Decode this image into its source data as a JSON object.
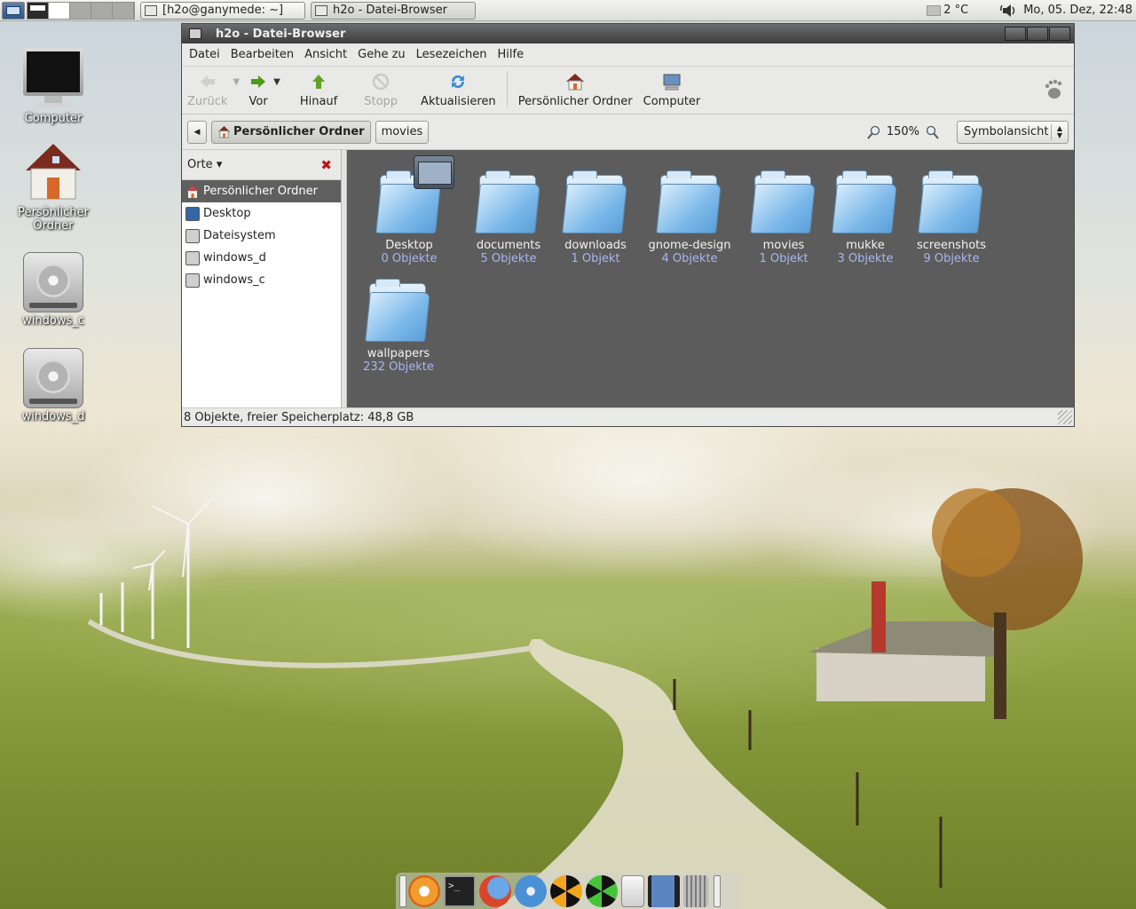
{
  "top_panel": {
    "tasks": [
      {
        "label": "[h2o@ganymede: ~]"
      },
      {
        "label": "h2o - Datei-Browser"
      }
    ],
    "weather": "2 °C",
    "clock": "Mo, 05. Dez, 22:48"
  },
  "desktop": {
    "icons": [
      {
        "label": "Computer"
      },
      {
        "label": "Persönlicher Ordner"
      },
      {
        "label": "windows_c"
      },
      {
        "label": "windows_d"
      }
    ]
  },
  "window": {
    "title": "h2o - Datei-Browser",
    "menu": [
      "Datei",
      "Bearbeiten",
      "Ansicht",
      "Gehe zu",
      "Lesezeichen",
      "Hilfe"
    ],
    "toolbar": {
      "back": "Zurück",
      "forward": "Vor",
      "up": "Hinauf",
      "stop": "Stopp",
      "reload": "Aktualisieren",
      "home": "Persönlicher Ordner",
      "computer": "Computer"
    },
    "location": {
      "crumbs": [
        "Persönlicher Ordner",
        "movies"
      ],
      "zoom": "150%",
      "view": "Symbolansicht"
    },
    "sidebar": {
      "header": "Orte",
      "items": [
        "Persönlicher Ordner",
        "Desktop",
        "Dateisystem",
        "windows_d",
        "windows_c"
      ]
    },
    "files": [
      {
        "name": "Desktop",
        "count": "0 Objekte"
      },
      {
        "name": "documents",
        "count": "5 Objekte"
      },
      {
        "name": "downloads",
        "count": "1 Objekt"
      },
      {
        "name": "gnome-design",
        "count": "4 Objekte"
      },
      {
        "name": "movies",
        "count": "1 Objekt"
      },
      {
        "name": "mukke",
        "count": "3 Objekte"
      },
      {
        "name": "screenshots",
        "count": "9 Objekte"
      },
      {
        "name": "wallpapers",
        "count": "232 Objekte"
      }
    ],
    "status": "8 Objekte, freier Speicherplatz: 48,8 GB"
  }
}
